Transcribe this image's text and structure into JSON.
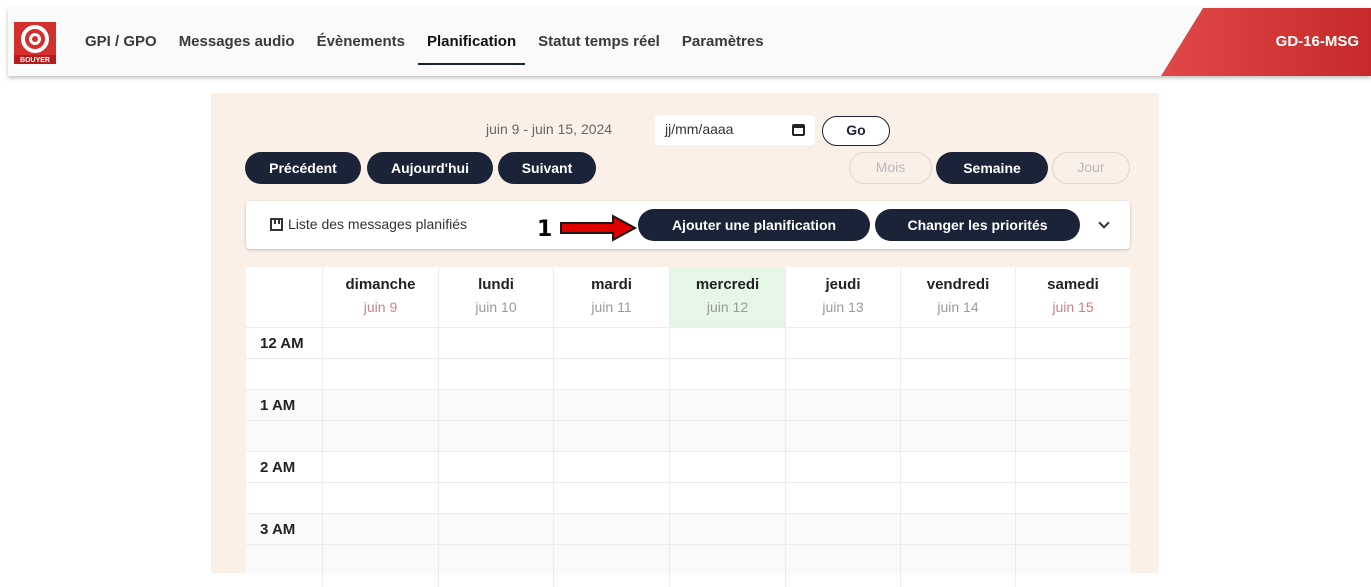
{
  "brand": {
    "logo_text": "BOUYER",
    "accent": "#d32f2f"
  },
  "nav": {
    "items": [
      {
        "label": "GPI / GPO"
      },
      {
        "label": "Messages audio"
      },
      {
        "label": "Évènements"
      },
      {
        "label": "Planification",
        "active": true
      },
      {
        "label": "Statut temps réel"
      },
      {
        "label": "Paramètres"
      }
    ]
  },
  "device": {
    "name": "GD-16-MSG"
  },
  "toolbar": {
    "range": "juin 9 - juin 15, 2024",
    "date_placeholder": "jj/mm/aaaa",
    "go_label": "Go",
    "prev_label": "Précédent",
    "today_label": "Aujourd'hui",
    "next_label": "Suivant",
    "month_label": "Mois",
    "week_label": "Semaine",
    "day_label": "Jour"
  },
  "planbar": {
    "list_label": "Liste des messages planifiés",
    "add_label": "Ajouter une planification",
    "priority_label": "Changer les priorités"
  },
  "callout": {
    "number": "1",
    "color": "#e00000"
  },
  "calendar": {
    "days": [
      {
        "name": "dimanche",
        "date": "juin 9"
      },
      {
        "name": "lundi",
        "date": "juin 10"
      },
      {
        "name": "mardi",
        "date": "juin 11"
      },
      {
        "name": "mercredi",
        "date": "juin 12"
      },
      {
        "name": "jeudi",
        "date": "juin 13"
      },
      {
        "name": "vendredi",
        "date": "juin 14"
      },
      {
        "name": "samedi",
        "date": "juin 15"
      }
    ],
    "times": [
      "12 AM",
      "1 AM",
      "2 AM",
      "3 AM"
    ]
  }
}
